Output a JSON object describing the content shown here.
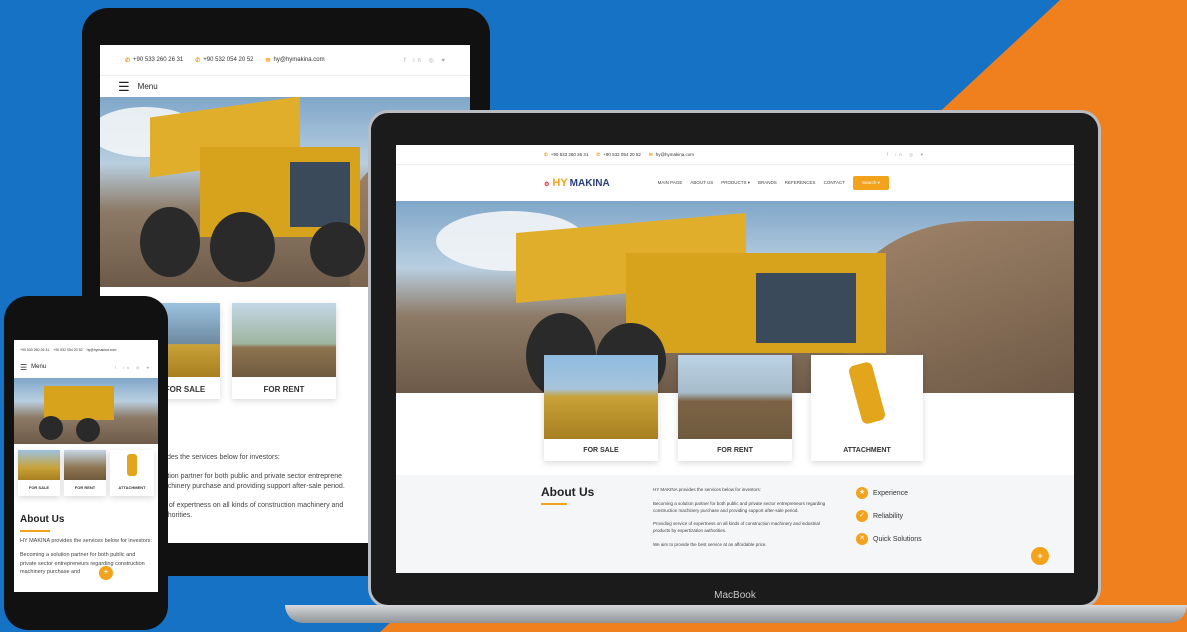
{
  "contact": {
    "phone1": "+90 533 260 26 31",
    "phone2": "+90 532 054 20 52",
    "email": "hy@hymakina.com",
    "social": "f in ◎ ♥"
  },
  "nav": {
    "menu_label": "Menu",
    "brand_hy": "HY",
    "brand_makina": "MAKINA",
    "items": [
      "MAIN PAGE",
      "ABOUT US",
      "PRODUCTS ▾",
      "BRANDS",
      "REFERENCES",
      "CONTACT"
    ],
    "cta": "Search ▾"
  },
  "cards": {
    "sale": "FOR SALE",
    "rent": "FOR RENT",
    "attachment": "ATTACHMENT",
    "phone_attachment": "ATTACHMENT"
  },
  "about": {
    "title": "About Us",
    "intro": "HY MAKINA provides the services below for investors:",
    "p1": "Becoming a solution partner for both public and private sector entrepreneurs regarding construction machinery purchase and providing support after-sale period.",
    "p2": "Providing service of expertness on all kinds of construction machinery and industrial products by expertization authorities.",
    "p3": "We aim to provide the best service at an affordable price.",
    "tablet_heading_partial": "s",
    "tablet_intro": "ovides the services below for investors:",
    "tablet_p1a": "olution partner for both public and private sector entreprene",
    "tablet_p1b": "machinery purchase and providing support after-sale period.",
    "tablet_p2a": "ice of expertness on all kinds of construction machinery and",
    "tablet_p2b": "authorities.",
    "phone_intro": "HY MAKINA provides the services below for investors:",
    "phone_p1": "Becoming a solution partner for both public and private sector entrepreneurs regarding construction machinery purchase and"
  },
  "features": [
    "Experience",
    "Reliability",
    "Quick Solutions"
  ],
  "device": {
    "laptop_brand": "MacBook"
  },
  "colors": {
    "accent": "#f3a21c",
    "bg_blue": "#1572c4",
    "bg_orange": "#f07f1e"
  }
}
